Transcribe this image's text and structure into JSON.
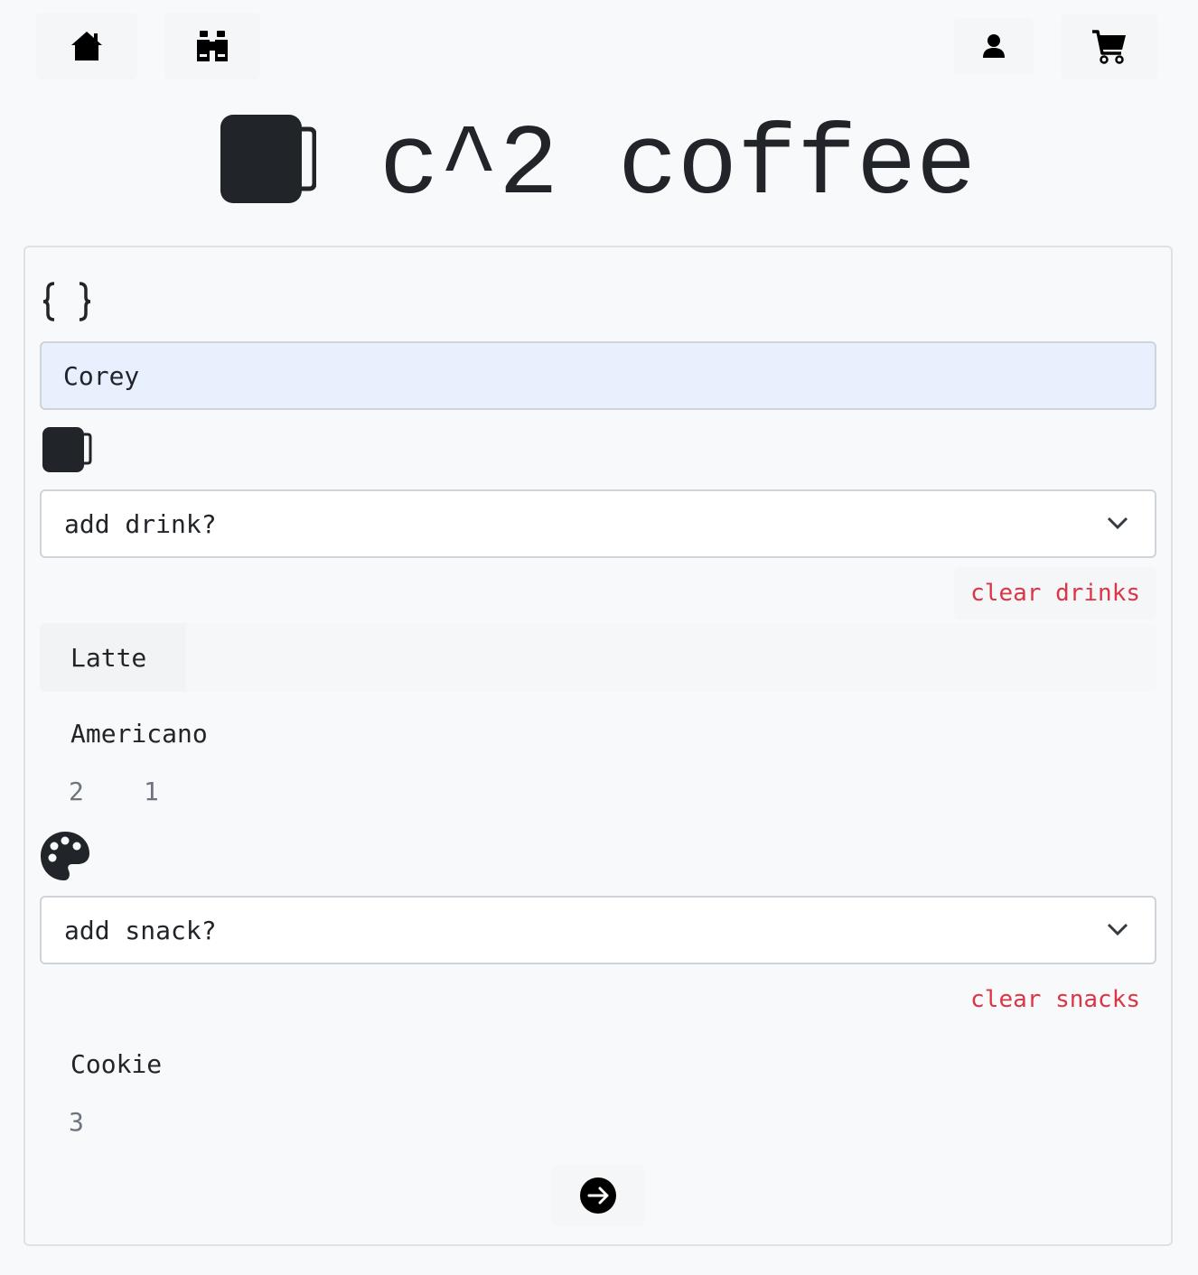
{
  "nav": {
    "left": [
      {
        "icon": "home-icon"
      },
      {
        "icon": "binoculars-icon"
      }
    ],
    "right": [
      {
        "icon": "user-icon"
      },
      {
        "icon": "cart-icon"
      }
    ]
  },
  "brand": {
    "title": "c^2 coffee",
    "icon": "mug-icon"
  },
  "form": {
    "code_icon": "braces-icon",
    "name_value": "Corey",
    "drinks": {
      "icon": "mug-icon",
      "select_label": "add drink?",
      "clear_label": "clear drinks",
      "items": [
        "Latte",
        "Americano"
      ],
      "quantities": [
        "2",
        "1"
      ]
    },
    "snacks": {
      "icon": "palette-icon",
      "select_label": "add snack?",
      "clear_label": "clear snacks",
      "items": [
        "Cookie"
      ],
      "quantities": [
        "3"
      ]
    },
    "submit_icon": "arrow-right-circle-icon"
  },
  "colors": {
    "background": "#f8f9fa",
    "text": "#212529",
    "danger": "#dc3545",
    "muted": "#6c757d",
    "input_fill": "#e8f0fe"
  }
}
